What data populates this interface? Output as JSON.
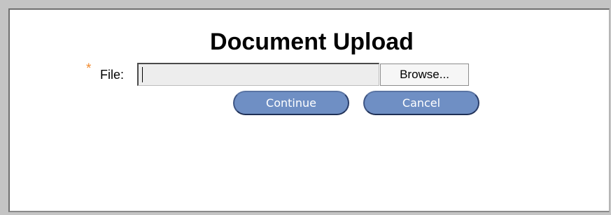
{
  "dialog": {
    "title": "Document Upload",
    "required_marker": "*",
    "file_label": "File:",
    "file_value": "",
    "browse_label": "Browse...",
    "continue_label": "Continue",
    "cancel_label": "Cancel"
  },
  "colors": {
    "required_marker": "#f28a2e",
    "button_fill": "#6f8fc4",
    "button_text": "#ffffff",
    "input_fill": "#ededed"
  }
}
